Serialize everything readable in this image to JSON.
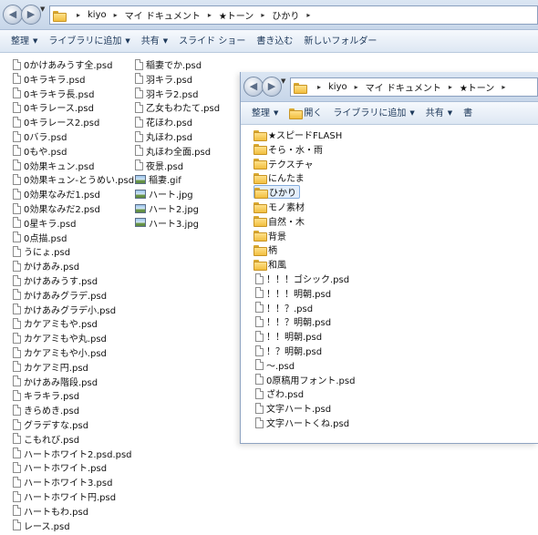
{
  "back_window": {
    "breadcrumb": [
      "kiyo",
      "マイ ドキュメント",
      "★トーン",
      "ひかり"
    ],
    "commands": [
      {
        "label": "整理",
        "dropdown": true
      },
      {
        "label": "ライブラリに追加",
        "dropdown": true
      },
      {
        "label": "共有",
        "dropdown": true
      },
      {
        "label": "スライド ショー",
        "dropdown": false
      },
      {
        "label": "書き込む",
        "dropdown": false
      },
      {
        "label": "新しいフォルダー",
        "dropdown": false
      }
    ],
    "files_col1": [
      "0かけあみうす全.psd",
      "0キラキラ.psd",
      "0キラキラ長.psd",
      "0キラレース.psd",
      "0キラレース2.psd",
      "0バラ.psd",
      "0もや.psd",
      "0効果キュン.psd",
      "0効果キュン-とうめい.psd",
      "0効果なみだ1.psd",
      "0効果なみだ2.psd",
      "0星キラ.psd",
      "0点描.psd",
      "うにょ.psd",
      "かけあみ.psd",
      "かけあみうす.psd",
      "かけあみグラデ.psd",
      "かけあみグラデ小.psd",
      "カケアミもや.psd",
      "カケアミもや丸.psd",
      "カケアミもや小.psd",
      "カケアミ円.psd",
      "かけあみ階段.psd",
      "キラキラ.psd",
      "きらめき.psd",
      "グラデすな.psd",
      "こもれび.psd",
      "ハートホワイト2.psd.psd",
      "ハートホワイト.psd",
      "ハートホワイト3.psd",
      "ハートホワイト円.psd",
      "ハートもわ.psd",
      "レース.psd"
    ],
    "files_col2": [
      {
        "name": "稲妻でか.psd",
        "type": "doc"
      },
      {
        "name": "羽キラ.psd",
        "type": "doc"
      },
      {
        "name": "羽キラ2.psd",
        "type": "doc"
      },
      {
        "name": "乙女もわたて.psd",
        "type": "doc"
      },
      {
        "name": "花ほわ.psd",
        "type": "doc"
      },
      {
        "name": "丸ほわ.psd",
        "type": "doc"
      },
      {
        "name": "丸ほわ全面.psd",
        "type": "doc"
      },
      {
        "name": "夜景.psd",
        "type": "doc"
      },
      {
        "name": "稲妻.gif",
        "type": "image"
      },
      {
        "name": "ハート.jpg",
        "type": "image"
      },
      {
        "name": "ハート2.jpg",
        "type": "image"
      },
      {
        "name": "ハート3.jpg",
        "type": "image"
      }
    ]
  },
  "front_window": {
    "breadcrumb": [
      "kiyo",
      "マイ ドキュメント",
      "★トーン"
    ],
    "commands": [
      {
        "label": "整理",
        "dropdown": true,
        "icon": ""
      },
      {
        "label": "開く",
        "dropdown": false,
        "icon": "open-folder-icon"
      },
      {
        "label": "ライブラリに追加",
        "dropdown": true,
        "icon": ""
      },
      {
        "label": "共有",
        "dropdown": true,
        "icon": ""
      },
      {
        "label": "書",
        "dropdown": false,
        "icon": ""
      }
    ],
    "folders": [
      "★スピードFLASH",
      "そら・水・雨",
      "テクスチャ",
      "にんたま",
      "ひかり",
      "モノ素材",
      "自然・木",
      "背景",
      "柄",
      "和風"
    ],
    "selected_folder": "ひかり",
    "files": [
      "！！！ゴシック.psd",
      "！！！明朝.psd",
      "！！？.psd",
      "！！？明朝.psd",
      "！！明朝.psd",
      "！？明朝.psd",
      "～.psd",
      "0原稿用フォント.psd",
      "ざわ.psd",
      "文字ハート.psd",
      "文字ハートくね.psd"
    ]
  }
}
